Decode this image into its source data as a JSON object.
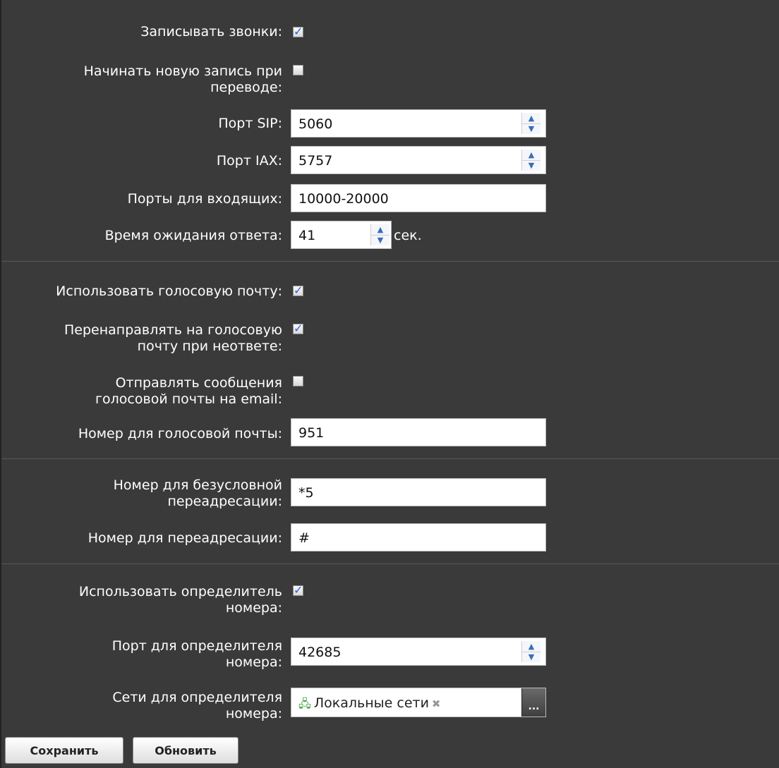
{
  "form": {
    "record_calls": {
      "label": "Записывать звонки:",
      "checked": true
    },
    "new_record_on_transfer": {
      "label_1": "Начинать новую запись при",
      "label_2": "переводе:",
      "checked": false
    },
    "sip_port": {
      "label": "Порт SIP:",
      "value": "5060"
    },
    "iax_port": {
      "label": "Порт IAX:",
      "value": "5757"
    },
    "incoming_ports": {
      "label": "Порты для входящих:",
      "value": "10000-20000"
    },
    "answer_timeout": {
      "label": "Время ожидания ответа:",
      "value": "41",
      "unit": "сек."
    },
    "use_voicemail": {
      "label": "Использовать голосовую почту:",
      "checked": true
    },
    "redirect_voicemail": {
      "label_1": "Перенаправлять на голосовую",
      "label_2": "почту при неответе:",
      "checked": true
    },
    "send_voicemail_email": {
      "label_1": "Отправлять сообщения",
      "label_2": "голосовой почты на email:",
      "checked": false
    },
    "voicemail_number": {
      "label": "Номер для голосовой почты:",
      "value": "951"
    },
    "unconditional_forward": {
      "label_1": "Номер для безусловной",
      "label_2": "переадресации:",
      "value": "*5"
    },
    "forward_number": {
      "label": "Номер для переадресации:",
      "value": "#"
    },
    "use_caller_id": {
      "label_1": "Использовать определитель",
      "label_2": "номера:",
      "checked": true
    },
    "caller_id_port": {
      "label_1": "Порт для определителя",
      "label_2": "номера:",
      "value": "42685"
    },
    "caller_id_networks": {
      "label_1": "Сети для определителя",
      "label_2": "номера:",
      "tag": "Локальные сети",
      "remove_glyph": "✖",
      "picker_glyph": "..."
    }
  },
  "buttons": {
    "save": "Сохранить",
    "refresh": "Обновить"
  },
  "icons": {
    "checkbox": "checkbox-icon",
    "spinner": "spinner-icon",
    "network": "network-icon"
  },
  "colors": {
    "panel": "#3a3a3a",
    "check": "#2b5fd9",
    "spinner": "#3b6db5",
    "network_icon": "#3c9b3c"
  }
}
